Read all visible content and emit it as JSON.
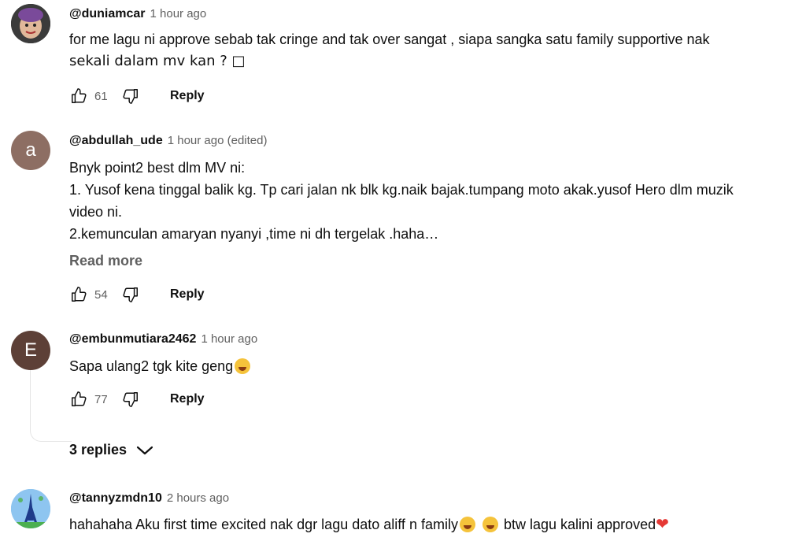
{
  "comments": [
    {
      "author": "@duniamcar",
      "time": "1 hour ago",
      "lines": [
        "for me lagu ni approve sebab tak cringe and tak over sangat , siapa sangka satu family supportive nak",
        "sekali dalam mv kan ? □"
      ],
      "likes": "61",
      "reply_label": "Reply",
      "avatar_icon": "user-photo-avatar"
    },
    {
      "author": "@abdullah_ude",
      "time": "1 hour ago (edited)",
      "avatar_letter": "a",
      "lines": [
        "Bnyk point2 best dlm MV ni:",
        "1. Yusof kena tinggal balik kg. Tp cari jalan nk blk kg.naik bajak.tumpang moto akak.yusof Hero dlm muzik",
        "video ni.",
        "2.kemunculan amaryan nyanyi ,time ni dh tergelak .haha…"
      ],
      "read_more": "Read more",
      "likes": "54",
      "reply_label": "Reply"
    },
    {
      "author": "@embunmutiara2462",
      "time": "1 hour ago",
      "avatar_letter": "E",
      "text": "Sapa ulang2 tgk kite geng",
      "likes": "77",
      "reply_label": "Reply",
      "replies_label": "3 replies"
    },
    {
      "author": "@tannyzmdn10",
      "time": "2 hours ago",
      "text_before": "hahahaha Aku first time excited nak dgr lagu dato aliff n family",
      "text_after": "btw lagu kalini approved",
      "avatar_icon": "eiffel-tower-avatar"
    }
  ],
  "colors": {
    "text": "#0f0f0f",
    "secondary": "#606060",
    "heart": "#e53935"
  }
}
